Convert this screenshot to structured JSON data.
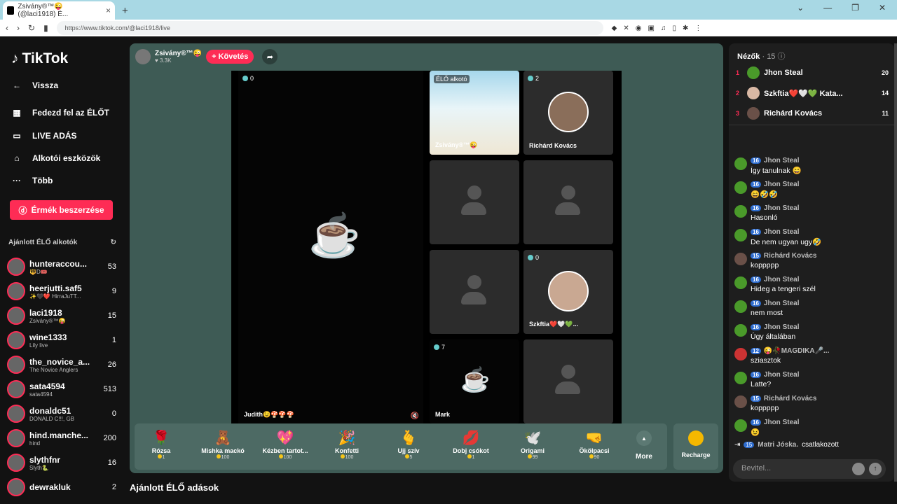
{
  "browser": {
    "tab_title": "Zsivány®™😜 (@laci1918) É...",
    "url": "https://www.tiktok.com/@laci1918/live"
  },
  "sidebar": {
    "logo": "TikTok",
    "nav": [
      {
        "icon": "←",
        "label": "Vissza"
      },
      {
        "icon": "▦",
        "label": "Fedezd fel az ÉLŐT"
      },
      {
        "icon": "▭",
        "label": "LIVE ADÁS"
      },
      {
        "icon": "⌂",
        "label": "Alkotói eszközök"
      },
      {
        "icon": "···",
        "label": "Több"
      }
    ],
    "coins_button": "Érmék beszerzése",
    "recommended_title": "Ajánlott ÉLŐ alkotók",
    "creators": [
      {
        "name": "hunteraccou...",
        "sub": "🔱D🎟️",
        "count": "53"
      },
      {
        "name": "heerjutti.saf5",
        "sub": "✨🖤❤️ HirraJuTT...",
        "count": "9"
      },
      {
        "name": "laci1918",
        "sub": "Zsivány®™😜",
        "count": "15"
      },
      {
        "name": "wine1333",
        "sub": "Lily live",
        "count": "1"
      },
      {
        "name": "the_novice_a...",
        "sub": "The Novice Anglers",
        "count": "26"
      },
      {
        "name": "sata4594",
        "sub": "sata4594",
        "count": "513"
      },
      {
        "name": "donaldc51",
        "sub": "DONALD C!!!, GB",
        "count": "0"
      },
      {
        "name": "hind.manche...",
        "sub": "hind",
        "count": "200"
      },
      {
        "name": "slythfnr",
        "sub": "Slyth🐍",
        "count": "16"
      },
      {
        "name": "dewrakluk",
        "sub": "",
        "count": "2"
      }
    ]
  },
  "live": {
    "host": "Zsivány®™😜",
    "likes": "♥ 3.3K",
    "follow": "+ Követés",
    "big_tile": {
      "count": "0",
      "name": "Judith😉🍄🍄🍄"
    },
    "tiles": [
      {
        "name": "Zsivány®™😜",
        "label": "ÉLŐ alkotó"
      },
      {
        "name": "Richárd Kovács",
        "count": "2"
      },
      {
        "name": "Szkftia❤️🤍💚...",
        "count": "0"
      },
      {
        "name": "Mark",
        "count": "7"
      }
    ],
    "gifts": [
      {
        "icon": "🌹",
        "name": "Rózsa",
        "price": "1"
      },
      {
        "icon": "🧸",
        "name": "Mishka mackó",
        "price": "100"
      },
      {
        "icon": "💖",
        "name": "Kézben tartot...",
        "price": "100"
      },
      {
        "icon": "🎉",
        "name": "Konfetti",
        "price": "100"
      },
      {
        "icon": "🫰",
        "name": "Ujj szív",
        "price": "5"
      },
      {
        "icon": "💋",
        "name": "Dobj csókot",
        "price": "1"
      },
      {
        "icon": "🕊️",
        "name": "Origami",
        "price": "99"
      },
      {
        "icon": "🤜",
        "name": "Ököl​pacsi",
        "price": "90"
      }
    ],
    "more": "More",
    "recharge": "Recharge",
    "recommended_below": "Ajánlott ÉLŐ adások"
  },
  "chat": {
    "viewers_title": "Nézők",
    "viewers_count": "· 15",
    "top_viewers": [
      {
        "rank": "1",
        "name": "Jhon Steal",
        "score": "20"
      },
      {
        "rank": "2",
        "name": "Szkftia❤️🤍💚 Kata...",
        "score": "14"
      },
      {
        "rank": "3",
        "name": "Richárd Kovács",
        "score": "11"
      }
    ],
    "messages": [
      {
        "user": "Jhon Steal",
        "lvl": "16",
        "text": "Így tanulnak 😄"
      },
      {
        "user": "Jhon Steal",
        "lvl": "16",
        "text": "😄🤣🤣"
      },
      {
        "user": "Jhon Steal",
        "lvl": "16",
        "text": "Hasonló"
      },
      {
        "user": "Jhon Steal",
        "lvl": "16",
        "text": "De nem ugyan ugy🤣"
      },
      {
        "user": "Richárd Kovács",
        "lvl": "15",
        "text": "koppppp"
      },
      {
        "user": "Jhon Steal",
        "lvl": "16",
        "text": "Hideg a tengeri szél"
      },
      {
        "user": "Jhon Steal",
        "lvl": "16",
        "text": "nem most"
      },
      {
        "user": "Jhon Steal",
        "lvl": "16",
        "text": "Úgy általában"
      },
      {
        "user": "😜🥀MAGDIKA🎤...",
        "lvl": "12",
        "text": "sziasztok"
      },
      {
        "user": "Jhon Steal",
        "lvl": "16",
        "text": "Latte?"
      },
      {
        "user": "Richárd Kovács",
        "lvl": "15",
        "text": "koppppp"
      },
      {
        "user": "Jhon Steal",
        "lvl": "16",
        "text": "😉"
      }
    ],
    "joined": {
      "user": "Matri Jóska.",
      "text": "csatlakozott",
      "lvl": "15"
    },
    "input_placeholder": "Bevitel..."
  }
}
